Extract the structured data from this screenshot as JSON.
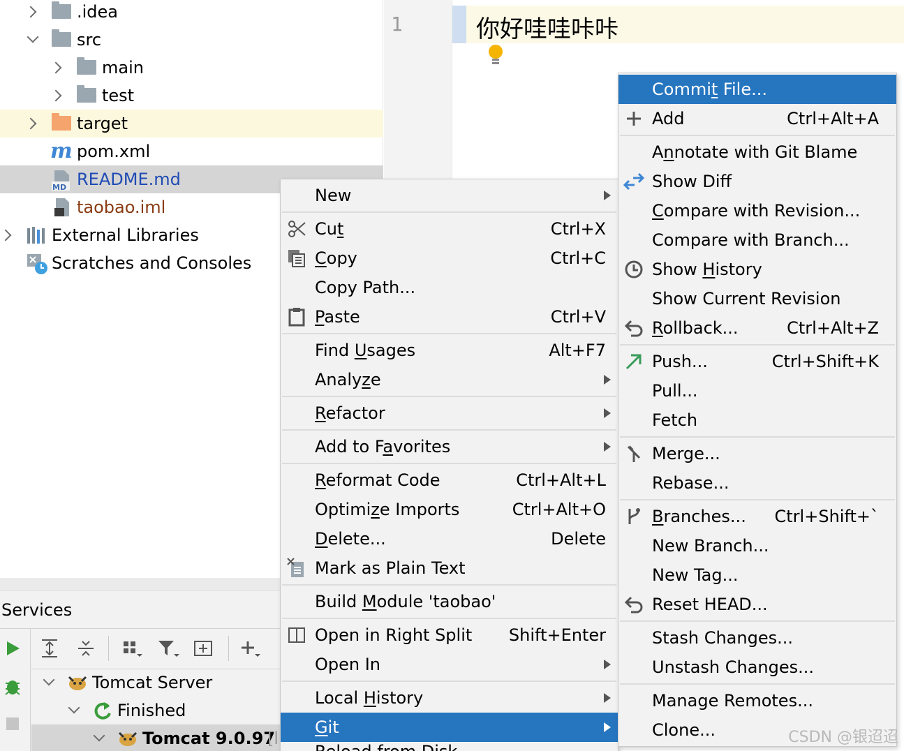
{
  "tree": {
    "items": [
      {
        "label": ".idea"
      },
      {
        "label": "src"
      },
      {
        "label": "main"
      },
      {
        "label": "test"
      },
      {
        "label": "target"
      },
      {
        "label": "pom.xml"
      },
      {
        "label": "README.md"
      },
      {
        "label": "taobao.iml"
      },
      {
        "label": "External Libraries"
      },
      {
        "label": "Scratches and Consoles"
      }
    ]
  },
  "editor": {
    "line_number": "1",
    "content": "你好哇哇咔咔"
  },
  "services": {
    "title": "Services",
    "nodes": [
      {
        "label": "Tomcat Server"
      },
      {
        "label": "Finished"
      },
      {
        "label": "Tomcat 9.0.97",
        "suffix": "[l"
      }
    ]
  },
  "context_menu": {
    "new": "New",
    "cut": {
      "pre": "Cu",
      "u": "t",
      "post": "",
      "shortcut": "Ctrl+X"
    },
    "copy": {
      "pre": "",
      "u": "C",
      "post": "opy",
      "shortcut": "Ctrl+C"
    },
    "copy_path": "Copy Path...",
    "paste": {
      "pre": "",
      "u": "P",
      "post": "aste",
      "shortcut": "Ctrl+V"
    },
    "find_usages": {
      "pre": "Find ",
      "u": "U",
      "post": "sages",
      "shortcut": "Alt+F7"
    },
    "analyze": {
      "pre": "Analy",
      "u": "z",
      "post": "e"
    },
    "refactor": {
      "pre": "",
      "u": "R",
      "post": "efactor"
    },
    "add_favorites": {
      "pre": "Add to F",
      "u": "a",
      "post": "vorites"
    },
    "reformat": {
      "pre": "",
      "u": "R",
      "post": "eformat Code",
      "shortcut": "Ctrl+Alt+L"
    },
    "optimize": {
      "pre": "Optimi",
      "u": "z",
      "post": "e Imports",
      "shortcut": "Ctrl+Alt+O"
    },
    "delete": {
      "pre": "",
      "u": "D",
      "post": "elete...",
      "shortcut": "Delete"
    },
    "mark_plain": "Mark as Plain Text",
    "build_module": {
      "pre": "Build ",
      "u": "M",
      "post": "odule 'taobao'"
    },
    "open_right_split": {
      "label": "Open in Right Split",
      "shortcut": "Shift+Enter"
    },
    "open_in": "Open In",
    "local_history": {
      "pre": "Local ",
      "u": "H",
      "post": "istory"
    },
    "git": {
      "pre": "",
      "u": "G",
      "post": "it"
    },
    "reload_partial": "Reload from Disk"
  },
  "git_menu": {
    "commit": {
      "pre": "Commi",
      "u": "t",
      "post": " File..."
    },
    "add": {
      "label": "Add",
      "shortcut": "Ctrl+Alt+A"
    },
    "annotate": {
      "pre": "A",
      "u": "n",
      "post": "notate with Git Blame"
    },
    "show_diff": "Show Diff",
    "compare_revision": {
      "pre": "",
      "u": "C",
      "post": "ompare with Revision..."
    },
    "compare_branch": "Compare with Branch...",
    "show_history": {
      "pre": "Show ",
      "u": "H",
      "post": "istory"
    },
    "show_current": "Show Current Revision",
    "rollback": {
      "pre": "",
      "u": "R",
      "post": "ollback...",
      "shortcut": "Ctrl+Alt+Z"
    },
    "push": {
      "label": "Push...",
      "shortcut": "Ctrl+Shift+K"
    },
    "pull": "Pull...",
    "fetch": "Fetch",
    "merge": "Merge...",
    "rebase": "Rebase...",
    "branches": {
      "pre": "",
      "u": "B",
      "post": "ranches...",
      "shortcut": "Ctrl+Shift+`"
    },
    "new_branch": "New Branch...",
    "new_tag": "New Tag...",
    "reset_head": "Reset HEAD...",
    "stash": "Stash Changes...",
    "unstash": "Unstash Changes...",
    "manage_remotes": "Manage Remotes...",
    "clone": "Clone..."
  },
  "watermark": "CSDN @银迢迢",
  "colors": {
    "selection_blue": "#2675bf",
    "readme_blue": "#1f4bb4",
    "iml_brown": "#8a3b12",
    "run_green": "#3a9c3a"
  }
}
